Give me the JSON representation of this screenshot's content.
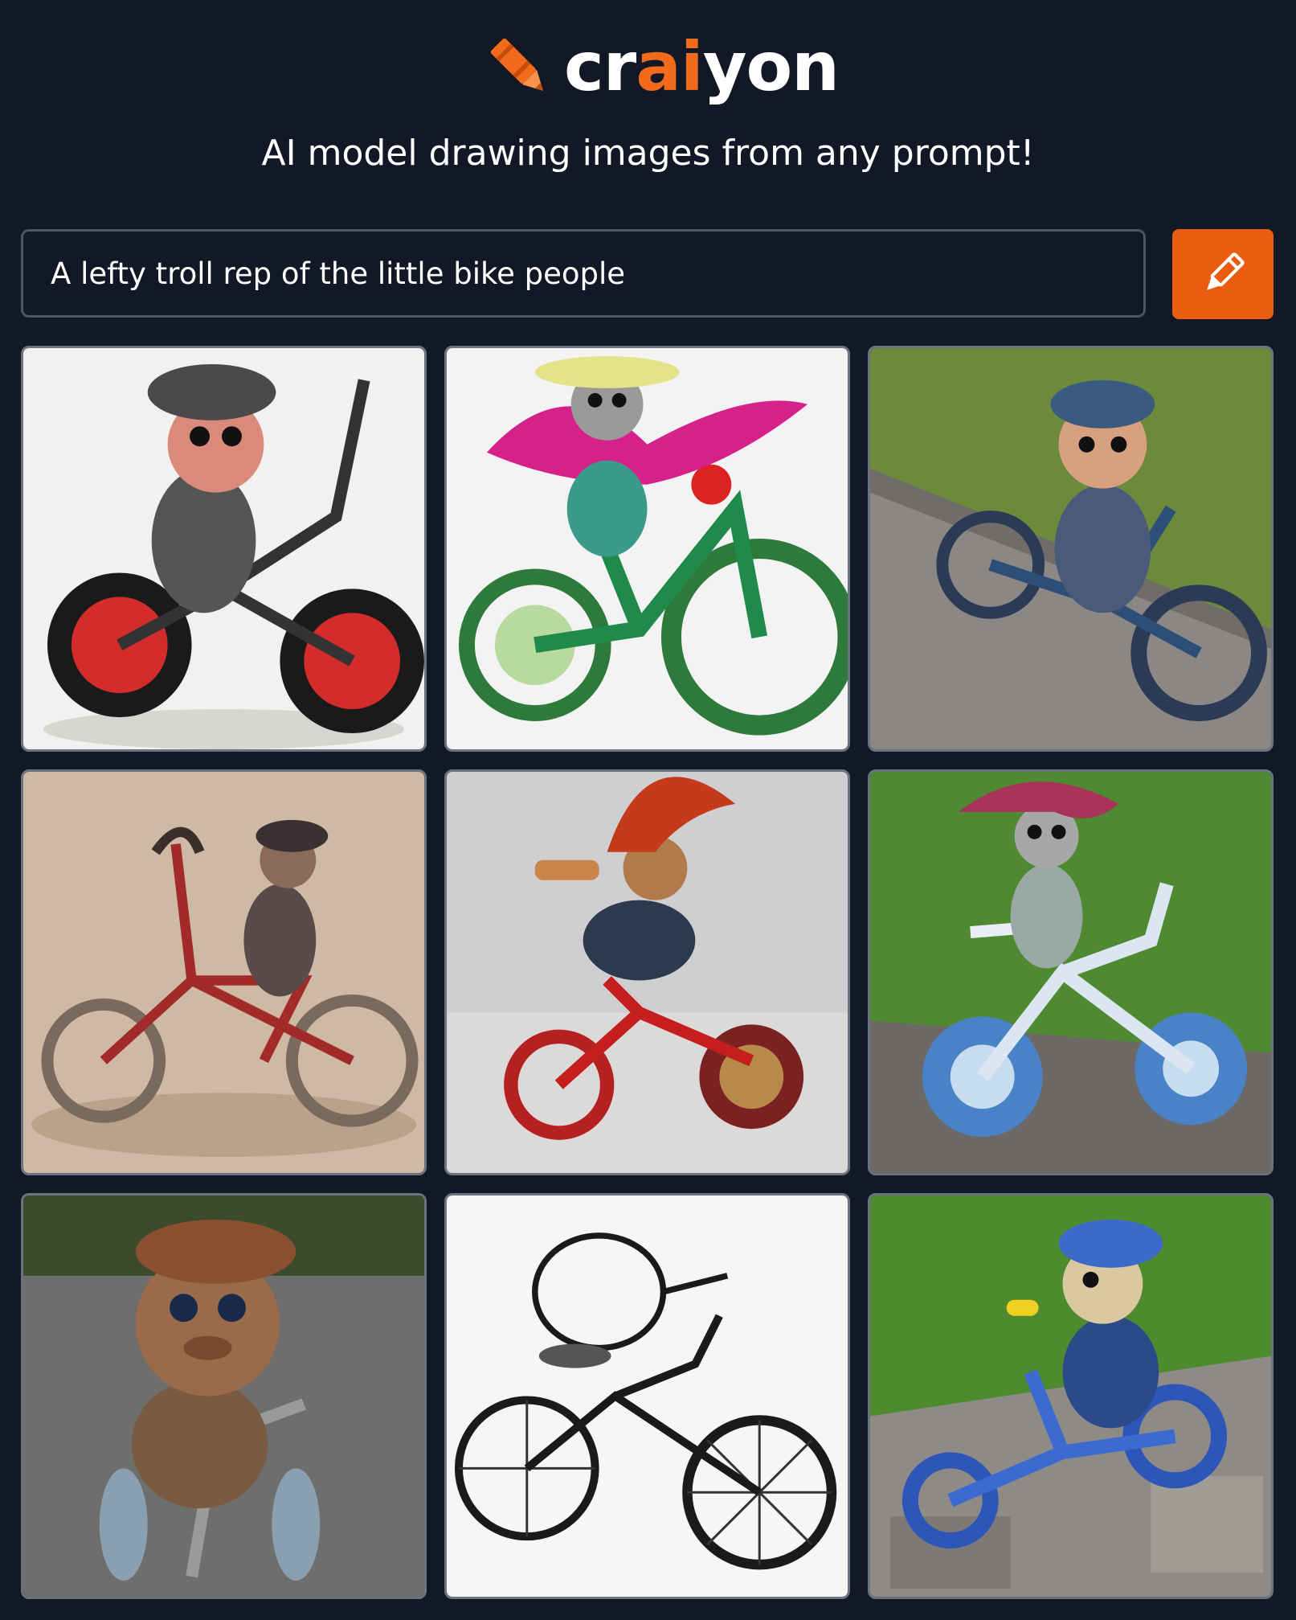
{
  "brand": {
    "logo_prefix": "cr",
    "logo_accent": "ai",
    "logo_suffix": "yon",
    "accent_color": "#f26a1b",
    "icon": "crayon-icon"
  },
  "tagline": "AI model drawing images from any prompt!",
  "prompt": {
    "value": "A lefty troll rep of the little bike people",
    "button_icon": "pencil-icon",
    "button_color": "#ea5d10"
  },
  "images": [
    {
      "description": "troll toy with cap on red-wheeled bicycle",
      "scene": "white"
    },
    {
      "description": "troll figure with pink feathers on green bicycle",
      "scene": "white"
    },
    {
      "description": "troll doll with blue helmet on blue bike on curb",
      "scene": "grass"
    },
    {
      "description": "sketch of figure riding thin bicycle",
      "scene": "beige"
    },
    {
      "description": "troll with red hair on red bicycle",
      "scene": "grey"
    },
    {
      "description": "troll with red hair on blue bicycle in grass",
      "scene": "grass"
    },
    {
      "description": "troll figurine with cap on bike on road",
      "scene": "road"
    },
    {
      "description": "ink sketch of person riding bicycle",
      "scene": "white"
    },
    {
      "description": "troll with blue cap on blue bike on stones",
      "scene": "grass"
    }
  ]
}
